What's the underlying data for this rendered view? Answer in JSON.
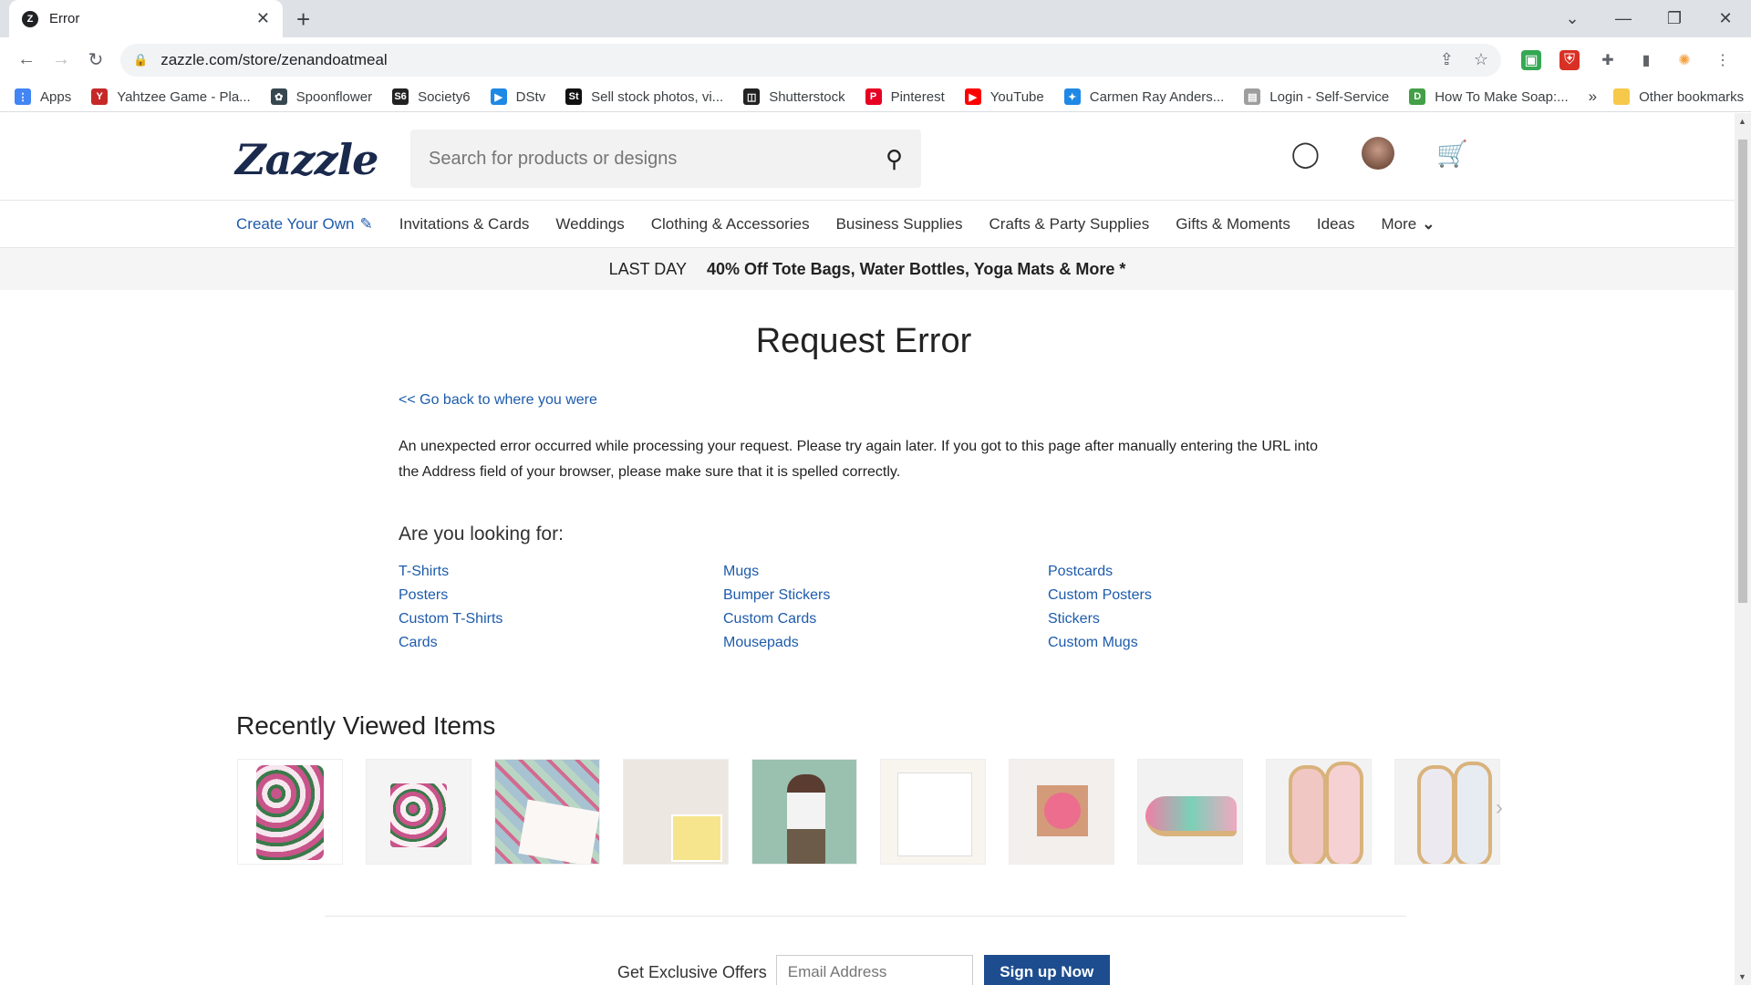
{
  "browser": {
    "tab_title": "Error",
    "tab_favicon": "Z",
    "url": "zazzle.com/store/zenandoatmeal",
    "bookmarks": [
      {
        "label": "Apps",
        "color": "#4285f4",
        "glyph": "⋮"
      },
      {
        "label": "Yahtzee Game - Pla...",
        "color": "#c62828",
        "glyph": "Y"
      },
      {
        "label": "Spoonflower",
        "color": "#37474f",
        "glyph": "✿"
      },
      {
        "label": "Society6",
        "color": "#222222",
        "glyph": "S6"
      },
      {
        "label": "DStv",
        "color": "#1e88e5",
        "glyph": "▶"
      },
      {
        "label": "Sell stock photos, vi...",
        "color": "#111111",
        "glyph": "St"
      },
      {
        "label": "Shutterstock",
        "color": "#222222",
        "glyph": "◫"
      },
      {
        "label": "Pinterest",
        "color": "#e60023",
        "glyph": "P"
      },
      {
        "label": "YouTube",
        "color": "#ff0000",
        "glyph": "▶"
      },
      {
        "label": "Carmen Ray Anders...",
        "color": "#1e88e5",
        "glyph": "✦"
      },
      {
        "label": "Login - Self-Service",
        "color": "#9e9e9e",
        "glyph": "▤"
      },
      {
        "label": "How To Make Soap:...",
        "color": "#43a047",
        "glyph": "D"
      }
    ],
    "bookmarks_overflow": "»",
    "other_bookmarks": "Other bookmarks"
  },
  "site": {
    "logo": "Zazzle",
    "search_placeholder": "Search for products or designs",
    "nav": [
      "Create Your Own",
      "Invitations & Cards",
      "Weddings",
      "Clothing & Accessories",
      "Business Supplies",
      "Crafts & Party Supplies",
      "Gifts & Moments",
      "Ideas",
      "More"
    ],
    "promo_last": "LAST DAY",
    "promo_deal": "40% Off Tote Bags, Water Bottles, Yoga Mats & More *"
  },
  "error": {
    "title": "Request Error",
    "go_back": "<< Go back to where you were",
    "message": "An unexpected error occurred while processing your request. Please try again later. If you got to this page after manually entering the URL into the Address field of your browser, please make sure that it is spelled correctly.",
    "looking_for": "Are you looking for:",
    "links": [
      [
        "T-Shirts",
        "Posters",
        "Custom T-Shirts",
        "Cards"
      ],
      [
        "Mugs",
        "Bumper Stickers",
        "Custom Cards",
        "Mousepads"
      ],
      [
        "Postcards",
        "Custom Posters",
        "Stickers",
        "Custom Mugs"
      ]
    ]
  },
  "recent": {
    "title": "Recently Viewed Items"
  },
  "offers": {
    "label": "Get Exclusive Offers",
    "email_placeholder": "Email Address",
    "button": "Sign up Now"
  }
}
